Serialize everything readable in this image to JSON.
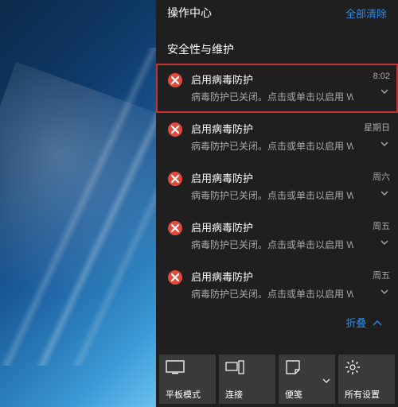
{
  "header": {
    "title": "操作中心",
    "clear_all": "全部清除"
  },
  "section_title": "安全性与维护",
  "notifications": [
    {
      "title": "启用病毒防护",
      "desc": "病毒防护已关闭。点击或单击以启用 Win",
      "time": "8:02",
      "highlight": true
    },
    {
      "title": "启用病毒防护",
      "desc": "病毒防护已关闭。点击或单击以启用 Win",
      "time": "星期日",
      "highlight": false
    },
    {
      "title": "启用病毒防护",
      "desc": "病毒防护已关闭。点击或单击以启用 Win",
      "time": "周六",
      "highlight": false
    },
    {
      "title": "启用病毒防护",
      "desc": "病毒防护已关闭。点击或单击以启用 Win",
      "time": "周五",
      "highlight": false
    },
    {
      "title": "启用病毒防护",
      "desc": "病毒防护已关闭。点击或单击以启用 Win",
      "time": "周五",
      "highlight": false
    }
  ],
  "collapse_label": "折叠",
  "quick_actions": [
    {
      "name": "tablet-mode",
      "label": "平板模式"
    },
    {
      "name": "connect",
      "label": "连接"
    },
    {
      "name": "note",
      "label": "便笺"
    },
    {
      "name": "all-settings",
      "label": "所有设置"
    }
  ],
  "colors": {
    "accent": "#2e8ae6",
    "error": "#e24a3b"
  }
}
